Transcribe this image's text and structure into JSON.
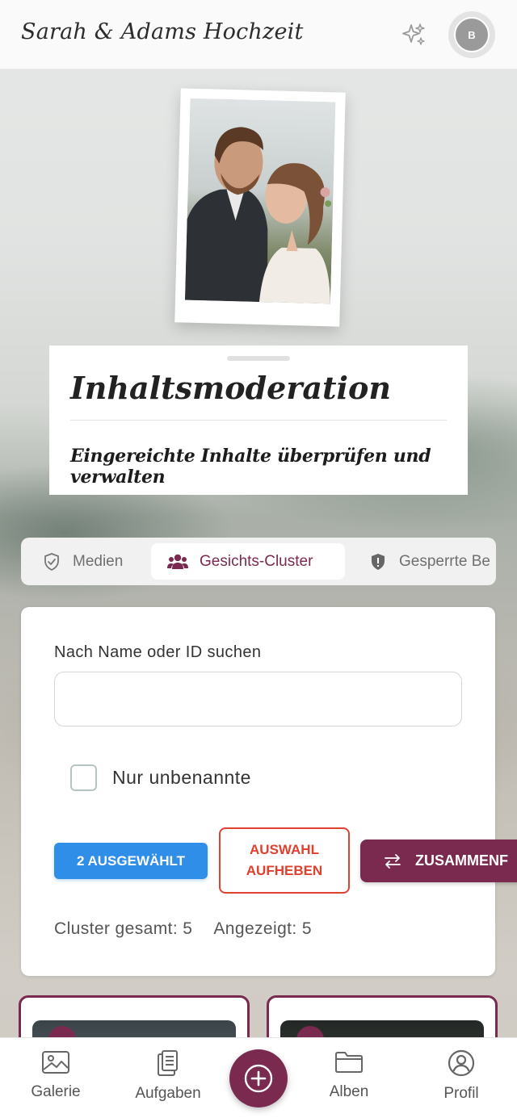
{
  "app": {
    "title": "Sarah & Adams Hochzeit",
    "avatar_initial": "B",
    "accent_color": "#7a2a4f"
  },
  "header_card": {
    "heading": "Inhaltsmoderation",
    "subheading": "Eingereichte Inhalte überprüfen und verwalten"
  },
  "tabs": [
    {
      "label": "Medien",
      "icon": "shield-check-icon",
      "active": false
    },
    {
      "label": "Gesichts-Cluster",
      "icon": "users-icon",
      "active": true
    },
    {
      "label": "Gesperrte Be",
      "icon": "shield-exclamation-icon",
      "active": false
    }
  ],
  "filters": {
    "search_label": "Nach Name oder ID suchen",
    "search_value": "",
    "unnamed_only_label": "Nur unbenannte",
    "unnamed_only_checked": false
  },
  "actions": {
    "selected_label": "2 AUSGEWÄHLT",
    "clear_selection_label": "AUSWAHL AUFHEBEN",
    "merge_label": "ZUSAMMENF",
    "selected_color": "#2e8ee8",
    "clear_color": "#e0412f"
  },
  "stats": {
    "total_label": "Cluster gesamt: 5",
    "shown_label": "Angezeigt: 5"
  },
  "clusters": [
    {
      "selected": true
    },
    {
      "selected": true
    }
  ],
  "bottom_nav": {
    "items": [
      {
        "label": "Galerie",
        "icon": "image-icon"
      },
      {
        "label": "Aufgaben",
        "icon": "clipboard-icon"
      },
      {
        "label": "Alben",
        "icon": "folder-icon"
      },
      {
        "label": "Profil",
        "icon": "user-circle-icon"
      }
    ],
    "fab_icon": "plus-circle-icon"
  }
}
